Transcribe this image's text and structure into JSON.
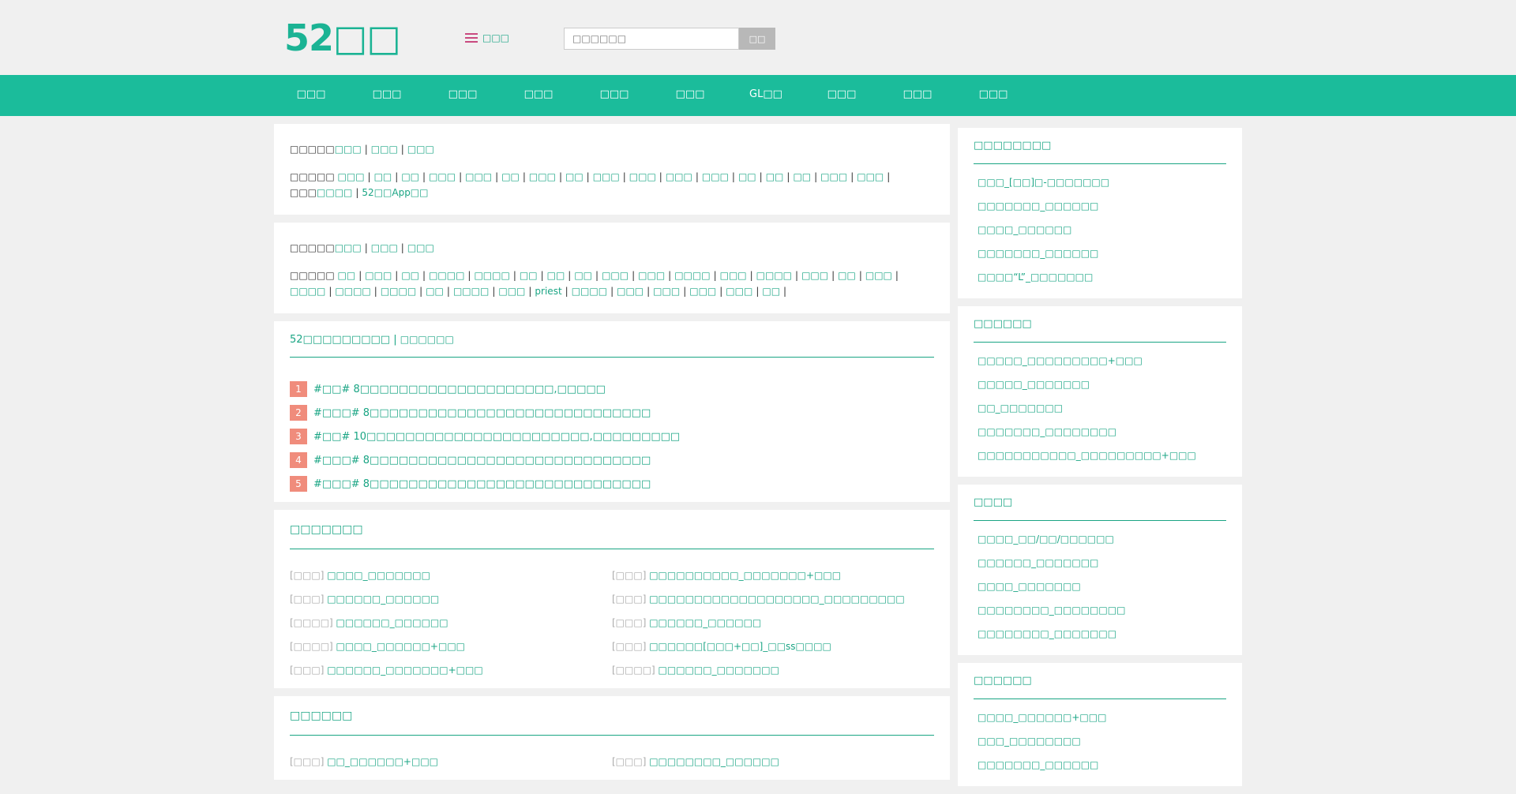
{
  "header": {
    "logo": "52□□",
    "category_label": "□□□",
    "search_placeholder": "□□□□□□",
    "search_button": "□□"
  },
  "nav": [
    "□□□",
    "□□□",
    "□□□",
    "□□□",
    "□□□",
    "□□□",
    "GL□□",
    "□□□",
    "□□□",
    "□□□"
  ],
  "tags1": {
    "row1_label": "□□□□□",
    "row1_links": [
      "□□□",
      "□□□",
      "□□□"
    ],
    "row2_label": "□□□□□",
    "row2_links": [
      "□□□",
      "□□",
      "□□",
      "□□□",
      "□□□",
      "□□",
      "□□□",
      "□□",
      "□□□",
      "□□□",
      "□□□",
      "□□□",
      "□□",
      "□□",
      "□□",
      "□□□",
      "□□□"
    ],
    "row2_tail_label": "□□□",
    "row2_tail_links": [
      "□□□□",
      "52□□App□□"
    ]
  },
  "tags2": {
    "row1_label": "□□□□□",
    "row1_links": [
      "□□□",
      "□□□",
      "□□□"
    ],
    "row2_label": "□□□□□",
    "row2_links": [
      "□□",
      "□□□",
      "□□",
      "□□□□",
      "□□□□",
      "□□",
      "□□",
      "□□",
      "□□□",
      "□□□",
      "□□□□",
      "□□□",
      "□□□□",
      "□□□",
      "□□",
      "□□□",
      "□□□□",
      "□□□□",
      "□□□□",
      "□□",
      "□□□□",
      "□□□",
      "priest",
      "□□□□",
      "□□□",
      "□□□",
      "□□□",
      "□□□",
      "□□"
    ]
  },
  "ranking": {
    "title": "52□□□□□□□□□",
    "subtitle": "□□□□□□",
    "items": [
      {
        "num": "1",
        "text": "#□□# 8□□□□□□□□□□□□□□□□□□□□,□□□□□"
      },
      {
        "num": "2",
        "text": "#□□□# 8□□□□□□□□□□□□□□□□□□□□□□□□□□□□□"
      },
      {
        "num": "3",
        "text": "#□□# 10□□□□□□□□□□□□□□□□□□□□□□□,□□□□□□□□□"
      },
      {
        "num": "4",
        "text": "#□□□# 8□□□□□□□□□□□□□□□□□□□□□□□□□□□□□"
      },
      {
        "num": "5",
        "text": "#□□□# 8□□□□□□□□□□□□□□□□□□□□□□□□□□□□□"
      }
    ]
  },
  "recommend": {
    "title": "□□□□□□□",
    "items": [
      {
        "cat": "[□□□]",
        "title": "□□□□_□□□□□□□"
      },
      {
        "cat": "[□□□]",
        "title": "□□□□□□□□□□_□□□□□□□+□□□"
      },
      {
        "cat": "[□□□]",
        "title": "□□□□□□_□□□□□□"
      },
      {
        "cat": "[□□□]",
        "title": "□□□□□□□□□□□□□□□□□□□_□□□□□□□□□"
      },
      {
        "cat": "[□□□□]",
        "title": "□□□□□□_□□□□□□"
      },
      {
        "cat": "[□□□]",
        "title": "□□□□□□_□□□□□□"
      },
      {
        "cat": "[□□□□]",
        "title": "□□□□_□□□□□□+□□□"
      },
      {
        "cat": "[□□□]",
        "title": "□□□□□□[□□□+□□]_□□ss□□□□"
      },
      {
        "cat": "[□□□]",
        "title": "□□□□□□_□□□□□□□+□□□"
      },
      {
        "cat": "[□□□□]",
        "title": "□□□□□□_□□□□□□□"
      }
    ]
  },
  "latest": {
    "title": "□□□□□□",
    "items": [
      {
        "cat": "[□□□]",
        "title": "□□_□□□□□□+□□□"
      },
      {
        "cat": "[□□□]",
        "title": "□□□□□□□□_□□□□□□"
      }
    ]
  },
  "sidebar": [
    {
      "title": "□□□□□□□□",
      "items": [
        "□□□_[□□]□-□□□□□□□",
        "□□□□□□□_□□□□□□",
        "□□□□_□□□□□□",
        "□□□□□□□_□□□□□□",
        "□□□□“L”_□□□□□□□"
      ]
    },
    {
      "title": "□□□□□□",
      "items": [
        "□□□□□_□□□□□□□□□+□□□",
        "□□□□□_□□□□□□□",
        "□□_□□□□□□□",
        "□□□□□□□_□□□□□□□□",
        "□□□□□□□□□□□_□□□□□□□□□+□□□"
      ]
    },
    {
      "title": "□□□□",
      "items": [
        "□□□□_□□/□□/□□□□□□",
        "□□□□□□_□□□□□□□",
        "□□□□_□□□□□□□",
        "□□□□□□□□_□□□□□□□□",
        "□□□□□□□□_□□□□□□□"
      ]
    },
    {
      "title": "□□□□□□",
      "items": [
        "□□□□_□□□□□□+□□□",
        "□□□_□□□□□□□□",
        "□□□□□□□_□□□□□□"
      ]
    }
  ]
}
